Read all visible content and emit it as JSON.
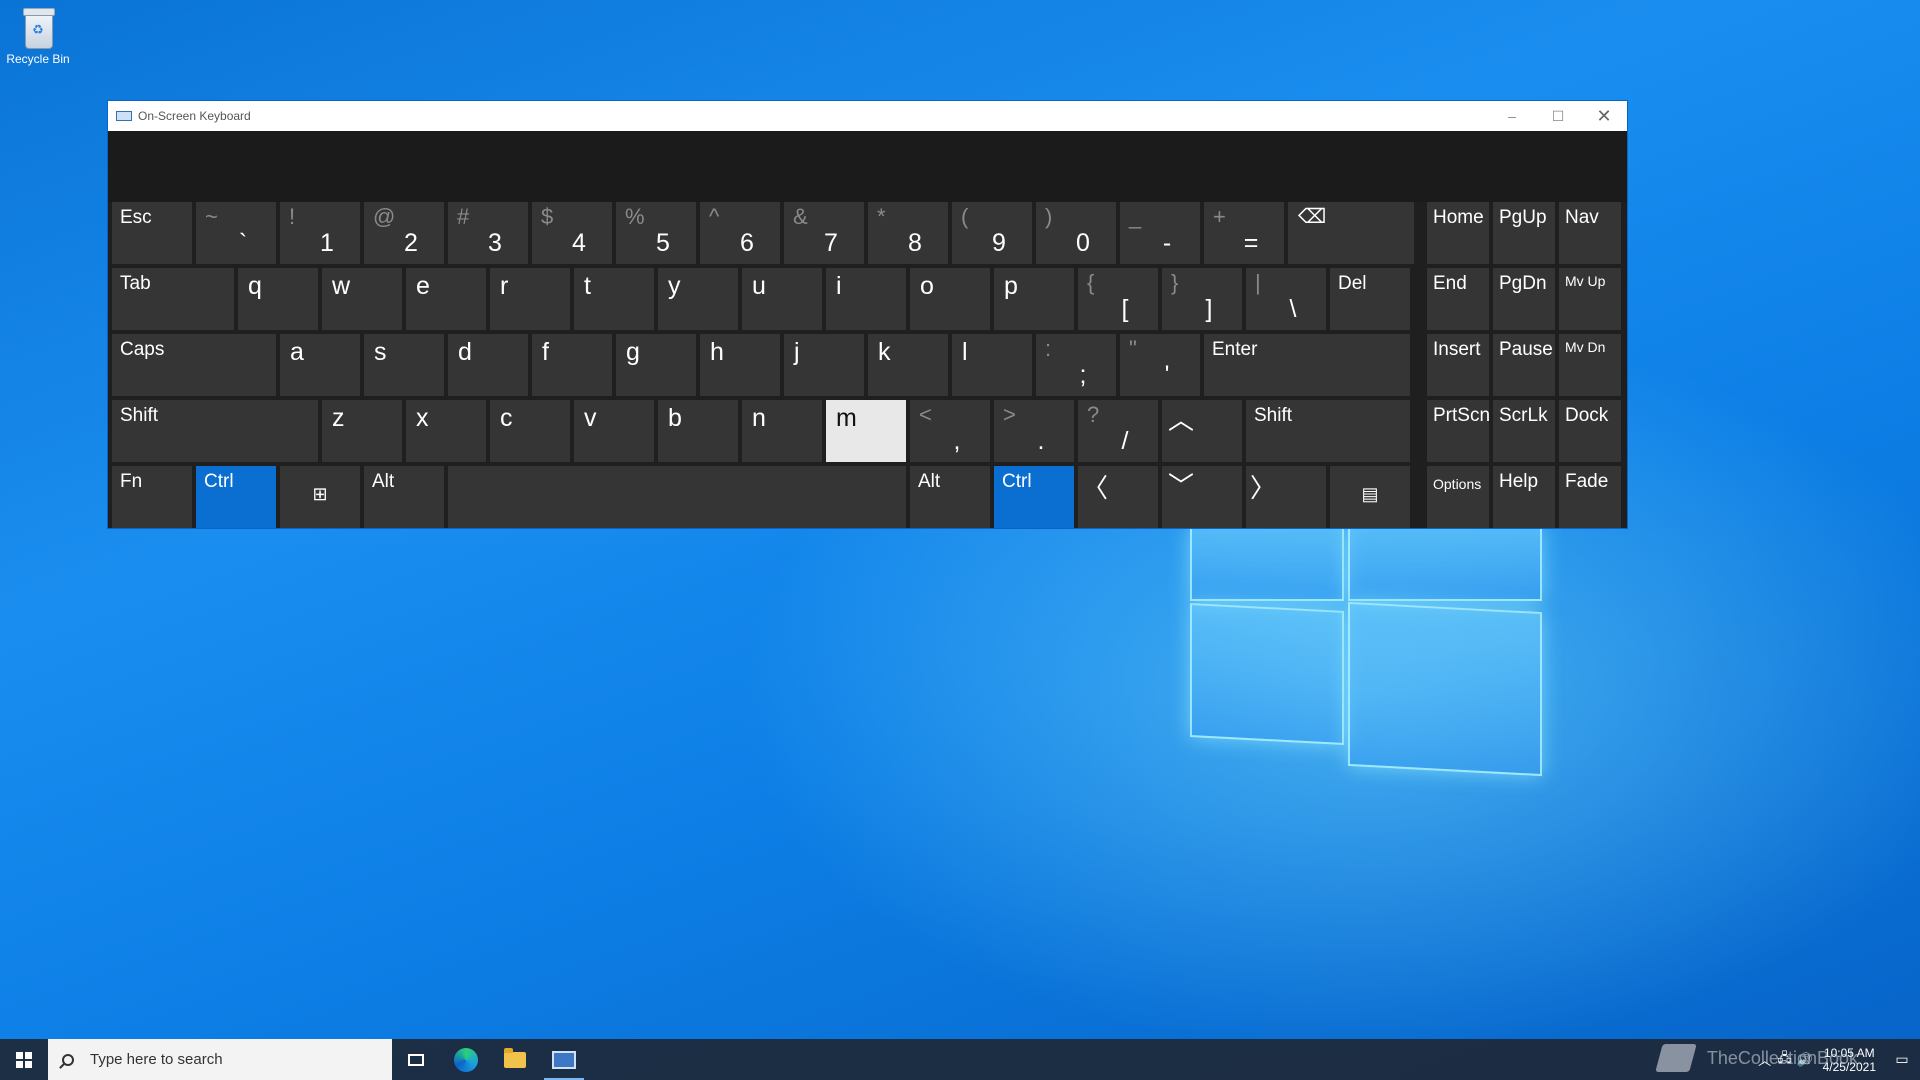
{
  "desktop": {
    "recycle_bin_label": "Recycle Bin"
  },
  "osk": {
    "title": "On-Screen Keyboard",
    "controls": {
      "minimize": "–",
      "maximize": "☐",
      "close": "✕"
    },
    "rows": [
      [
        {
          "id": "esc",
          "label": "Esc"
        },
        {
          "id": "backtick",
          "sym": "~",
          "main": "`"
        },
        {
          "id": "1",
          "sym": "!",
          "main": "1"
        },
        {
          "id": "2",
          "sym": "@",
          "main": "2"
        },
        {
          "id": "3",
          "sym": "#",
          "main": "3"
        },
        {
          "id": "4",
          "sym": "$",
          "main": "4"
        },
        {
          "id": "5",
          "sym": "%",
          "main": "5"
        },
        {
          "id": "6",
          "sym": "^",
          "main": "6"
        },
        {
          "id": "7",
          "sym": "&",
          "main": "7"
        },
        {
          "id": "8",
          "sym": "*",
          "main": "8"
        },
        {
          "id": "9",
          "sym": "(",
          "main": "9"
        },
        {
          "id": "0",
          "sym": ")",
          "main": "0"
        },
        {
          "id": "minus",
          "sym": "_",
          "main": "-"
        },
        {
          "id": "equals",
          "sym": "+",
          "main": "="
        },
        {
          "id": "backspace",
          "icon": "⌫"
        }
      ],
      [
        {
          "id": "tab",
          "label": "Tab"
        },
        {
          "id": "q",
          "single": "q"
        },
        {
          "id": "w",
          "single": "w"
        },
        {
          "id": "e",
          "single": "e"
        },
        {
          "id": "r",
          "single": "r"
        },
        {
          "id": "t",
          "single": "t"
        },
        {
          "id": "y",
          "single": "y"
        },
        {
          "id": "u",
          "single": "u"
        },
        {
          "id": "i",
          "single": "i"
        },
        {
          "id": "o",
          "single": "o"
        },
        {
          "id": "p",
          "single": "p"
        },
        {
          "id": "lbracket",
          "sym": "{",
          "main": "["
        },
        {
          "id": "rbracket",
          "sym": "}",
          "main": "]"
        },
        {
          "id": "backslash",
          "sym": "|",
          "main": "\\"
        },
        {
          "id": "del",
          "label": "Del"
        }
      ],
      [
        {
          "id": "caps",
          "label": "Caps"
        },
        {
          "id": "a",
          "single": "a"
        },
        {
          "id": "s",
          "single": "s"
        },
        {
          "id": "d",
          "single": "d"
        },
        {
          "id": "f",
          "single": "f"
        },
        {
          "id": "g",
          "single": "g"
        },
        {
          "id": "h",
          "single": "h"
        },
        {
          "id": "j",
          "single": "j"
        },
        {
          "id": "k",
          "single": "k"
        },
        {
          "id": "l",
          "single": "l"
        },
        {
          "id": "semicolon",
          "sym": ":",
          "main": ";"
        },
        {
          "id": "quote",
          "sym": "\"",
          "main": "'"
        },
        {
          "id": "enter",
          "label": "Enter"
        }
      ],
      [
        {
          "id": "lshift",
          "label": "Shift"
        },
        {
          "id": "z",
          "single": "z"
        },
        {
          "id": "x",
          "single": "x"
        },
        {
          "id": "c",
          "single": "c"
        },
        {
          "id": "v",
          "single": "v"
        },
        {
          "id": "b",
          "single": "b"
        },
        {
          "id": "n",
          "single": "n"
        },
        {
          "id": "m",
          "single": "m"
        },
        {
          "id": "comma",
          "sym": "<",
          "main": ","
        },
        {
          "id": "period",
          "sym": ">",
          "main": "."
        },
        {
          "id": "slash",
          "sym": "?",
          "main": "/"
        },
        {
          "id": "up",
          "icon": "︿"
        },
        {
          "id": "rshift",
          "label": "Shift"
        }
      ],
      [
        {
          "id": "fn",
          "label": "Fn"
        },
        {
          "id": "lctrl",
          "label": "Ctrl"
        },
        {
          "id": "win",
          "icon": "⊞"
        },
        {
          "id": "lalt",
          "label": "Alt"
        },
        {
          "id": "space",
          "label": ""
        },
        {
          "id": "ralt",
          "label": "Alt"
        },
        {
          "id": "rctrl",
          "label": "Ctrl"
        },
        {
          "id": "left",
          "icon": "〈"
        },
        {
          "id": "down",
          "icon": "﹀"
        },
        {
          "id": "right",
          "icon": "〉"
        },
        {
          "id": "menu",
          "icon": "▤"
        }
      ]
    ],
    "nav": [
      [
        "Home",
        "PgUp",
        "Nav"
      ],
      [
        "End",
        "PgDn",
        "Mv Up"
      ],
      [
        "Insert",
        "Pause",
        "Mv Dn"
      ],
      [
        "PrtScn",
        "ScrLk",
        "Dock"
      ],
      [
        "Options",
        "Help",
        "Fade"
      ]
    ],
    "state": {
      "pressed_key": "m",
      "active_keys": [
        "lctrl",
        "rctrl"
      ]
    }
  },
  "taskbar": {
    "search_placeholder": "Type here to search",
    "clock_time": "10:05 AM",
    "clock_date": "4/25/2021",
    "watermark": "TheCollectionBook"
  },
  "colors": {
    "accent": "#0a6fd1",
    "key_bg": "#353535",
    "window_bg": "#1f1f1f"
  }
}
